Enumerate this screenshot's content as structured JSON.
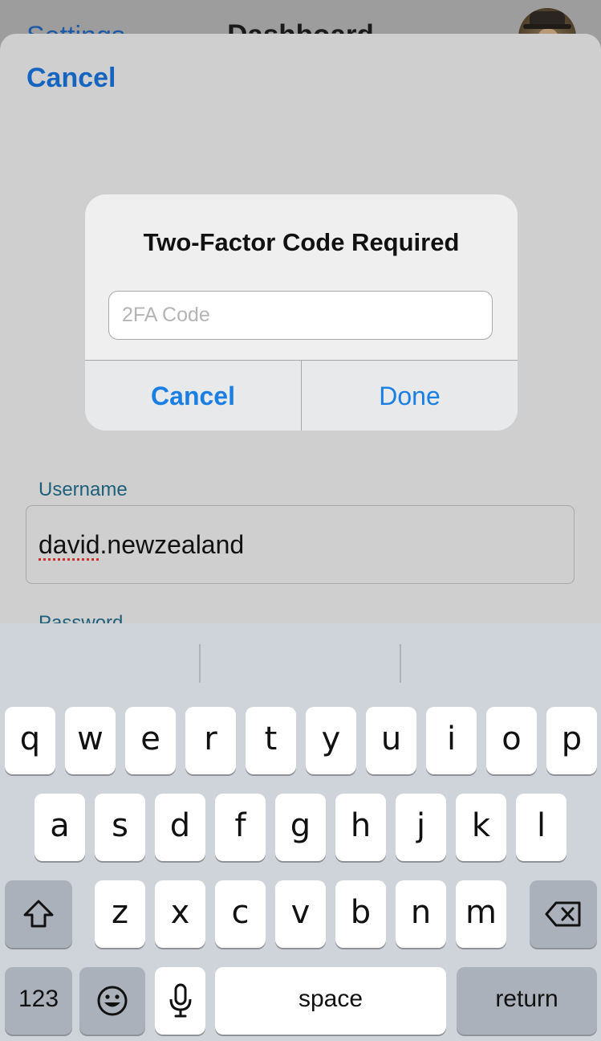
{
  "background_nav": {
    "left_label": "Settings",
    "title": "Dashboard"
  },
  "sheet": {
    "cancel_label": "Cancel",
    "username_label": "Username",
    "username_value_misspelled": "david",
    "username_value_rest": ".newzealand",
    "password_label": "Password"
  },
  "alert": {
    "title": "Two-Factor Code Required",
    "input_placeholder": "2FA Code",
    "input_value": "",
    "cancel_label": "Cancel",
    "done_label": "Done"
  },
  "keyboard": {
    "row1": [
      "q",
      "w",
      "e",
      "r",
      "t",
      "y",
      "u",
      "i",
      "o",
      "p"
    ],
    "row2": [
      "a",
      "s",
      "d",
      "f",
      "g",
      "h",
      "j",
      "k",
      "l"
    ],
    "row3": [
      "z",
      "x",
      "c",
      "v",
      "b",
      "n",
      "m"
    ],
    "numbers_label": "123",
    "space_label": "space",
    "return_label": "return",
    "shift_icon": "shift-arrow-icon",
    "delete_icon": "backspace-icon",
    "emoji_icon": "smiley-face-icon",
    "mic_icon": "microphone-icon"
  },
  "colors": {
    "accent": "#1a7ee3",
    "sheet_link": "#1565c0",
    "label_teal": "#1e5f7a",
    "keyboard_bg": "#cfd4da"
  }
}
